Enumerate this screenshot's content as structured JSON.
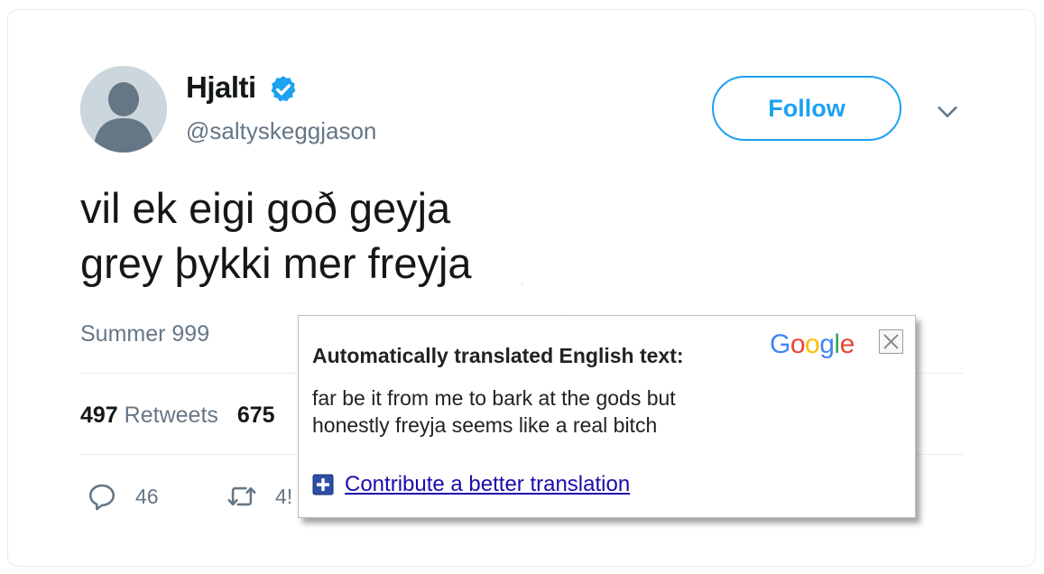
{
  "tweet": {
    "display_name": "Hjalti",
    "handle": "@saltyskeggjason",
    "follow_label": "Follow",
    "text_lines": [
      "vil ek eigi goð geyja",
      "grey þykki mer freyja"
    ],
    "timestamp": "Summer 999",
    "retweets_count": "497",
    "retweets_label": "Retweets",
    "likes_count_partial": "675",
    "reply_count": "46",
    "retweet_action_count_partial": "4!"
  },
  "translate_popup": {
    "heading": "Automatically translated English text:",
    "logo_letters": [
      {
        "char": "G",
        "color": "#4285f4"
      },
      {
        "char": "o",
        "color": "#ea4335"
      },
      {
        "char": "o",
        "color": "#fbbc05"
      },
      {
        "char": "g",
        "color": "#4285f4"
      },
      {
        "char": "l",
        "color": "#34a853"
      },
      {
        "char": "e",
        "color": "#ea4335"
      }
    ],
    "translation_lines": [
      "far be it from me to bark at the gods but",
      "honestly freyja seems like a real bitch"
    ],
    "contribute_link": "Contribute a better translation"
  },
  "colors": {
    "twitter_blue": "#1da1f2",
    "text_dark": "#14171a",
    "text_grey": "#657786",
    "link_blue": "#1a0dab"
  },
  "icons": [
    "default-avatar-icon",
    "verified-badge-icon",
    "chevron-down-icon",
    "reply-icon",
    "retweet-icon",
    "close-icon",
    "plus-icon"
  ]
}
